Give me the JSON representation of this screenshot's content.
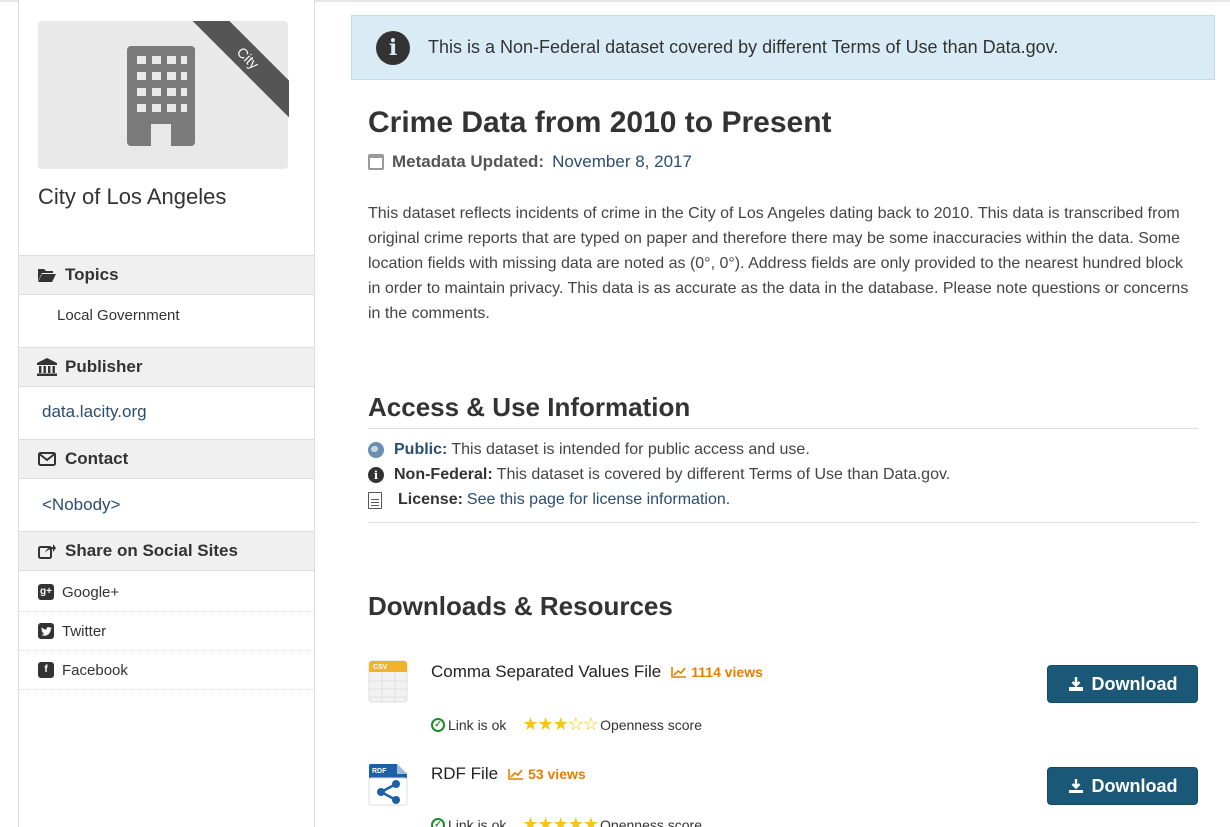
{
  "notice": {
    "text": "This is a Non-Federal dataset covered by different Terms of Use than Data.gov."
  },
  "sidebar": {
    "ribbon": "City",
    "org_name": "City of Los Angeles",
    "topics": {
      "label": "Topics",
      "items": [
        "Local Government"
      ]
    },
    "publisher": {
      "label": "Publisher",
      "value": "data.lacity.org"
    },
    "contact": {
      "label": "Contact",
      "value": "<Nobody>"
    },
    "social": {
      "label": "Share on Social Sites",
      "items": [
        {
          "label": "Google+",
          "icon": "google-plus-icon"
        },
        {
          "label": "Twitter",
          "icon": "twitter-icon"
        },
        {
          "label": "Facebook",
          "icon": "facebook-icon"
        }
      ]
    }
  },
  "dataset": {
    "title": "Crime Data from 2010 to Present",
    "metadata_label": "Metadata Updated:",
    "metadata_date": "November 8, 2017",
    "description": "This dataset reflects incidents of crime in the City of Los Angeles dating back to 2010. This data is transcribed from original crime reports that are typed on paper and therefore there may be some inaccuracies within the data. Some location fields with missing data are noted as (0°, 0°). Address fields are only provided to the nearest hundred block in order to maintain privacy. This data is as accurate as the data in the database. Please note questions or concerns in the comments."
  },
  "access": {
    "heading": "Access & Use Information",
    "public_label": "Public:",
    "public_text": "This dataset is intended for public access and use.",
    "nonfederal_label": "Non-Federal:",
    "nonfederal_text": "This dataset is covered by different Terms of Use than Data.gov.",
    "license_label": "License:",
    "license_link": "See this page for license information."
  },
  "downloads": {
    "heading": "Downloads & Resources",
    "resources": [
      {
        "name": "Comma Separated Values File",
        "views": "1114 views",
        "icon_label": "CSV",
        "link_status": "Link is ok",
        "openness_label": "Openness score",
        "stars": 3,
        "max_stars": 5,
        "button": "Download"
      },
      {
        "name": "RDF File",
        "views": "53 views",
        "icon_label": "RDF",
        "link_status": "Link is ok",
        "openness_label": "Openness score",
        "stars": 5,
        "max_stars": 5,
        "button": "Download"
      }
    ]
  },
  "colors": {
    "accent": "#1b5878",
    "link": "#2a4d72",
    "views": "#e67e00",
    "notice_bg": "#d9ecf5",
    "ok": "#1a8b2b"
  }
}
